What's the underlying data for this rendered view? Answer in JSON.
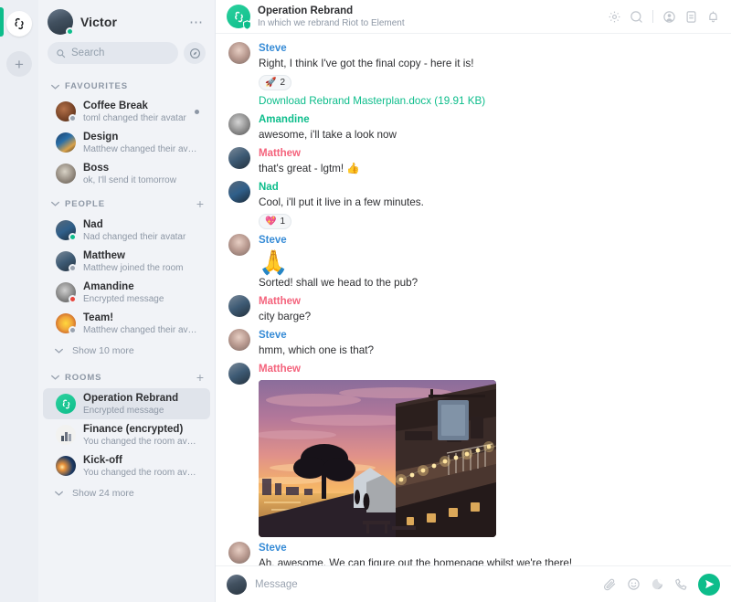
{
  "rail": {
    "home_icon": "element-logo-icon",
    "add_icon": "plus-icon",
    "accent_color": "#0dbd8b"
  },
  "sidebar": {
    "user": {
      "name": "Victor",
      "presence": "online",
      "menu_icon": "more-options-icon"
    },
    "search": {
      "placeholder": "Search",
      "icon": "search-icon",
      "explore_icon": "explore-compass-icon"
    },
    "sections": [
      {
        "title": "FAVOURITES",
        "has_add": false,
        "rooms": [
          {
            "name": "Coffee Break",
            "preview": "toml changed their avatar",
            "unread": true,
            "presence": "",
            "avatar": "coffee",
            "selected": false
          },
          {
            "name": "Design",
            "preview": "Matthew changed their avatar",
            "unread": false,
            "presence": "",
            "avatar": "design",
            "selected": false
          },
          {
            "name": "Boss",
            "preview": "ok, I'll send it tomorrow",
            "unread": false,
            "presence": "",
            "avatar": "boss",
            "selected": false
          }
        ],
        "show_more": ""
      },
      {
        "title": "PEOPLE",
        "has_add": true,
        "rooms": [
          {
            "name": "Nad",
            "preview": "Nad changed their avatar",
            "unread": false,
            "presence": "online",
            "avatar": "nad",
            "selected": false
          },
          {
            "name": "Matthew",
            "preview": "Matthew joined the room",
            "unread": false,
            "presence": "away",
            "avatar": "matthew",
            "selected": false
          },
          {
            "name": "Amandine",
            "preview": "Encrypted message",
            "unread": false,
            "presence": "busy",
            "avatar": "amandine",
            "selected": false
          },
          {
            "name": "Team!",
            "preview": "Matthew changed their avatar",
            "unread": false,
            "presence": "away",
            "avatar": "team",
            "selected": false
          }
        ],
        "show_more": "Show 10 more"
      },
      {
        "title": "ROOMS",
        "has_add": true,
        "rooms": [
          {
            "name": "Operation Rebrand",
            "preview": "Encrypted message",
            "unread": false,
            "presence": "",
            "avatar": "rebrand",
            "selected": true
          },
          {
            "name": "Finance (encrypted)",
            "preview": "You changed the room avatar",
            "unread": false,
            "presence": "",
            "avatar": "finance",
            "selected": false
          },
          {
            "name": "Kick-off",
            "preview": "You changed the room avatar",
            "unread": false,
            "presence": "",
            "avatar": "kickoff",
            "selected": false
          }
        ],
        "show_more": "Show 24 more"
      }
    ]
  },
  "room_header": {
    "title": "Operation Rebrand",
    "topic": "In which we rebrand Riot to Element",
    "icons": [
      "settings-gear-icon",
      "search-icon",
      "room-members-icon",
      "room-info-icon",
      "notifications-bell-icon"
    ]
  },
  "timeline": {
    "messages": [
      {
        "sender": "Steve",
        "sender_class": "s-steve",
        "avatar": "steve",
        "text": "Right, I think I've got the final copy - here it is!",
        "reaction": {
          "emoji": "🚀",
          "count": "2"
        },
        "file": "Download Rebrand Masterplan.docx (19.91 KB)"
      },
      {
        "sender": "Amandine",
        "sender_class": "s-amandine",
        "avatar": "amandine",
        "text": "awesome, i'll take a look now"
      },
      {
        "sender": "Matthew",
        "sender_class": "s-matthew",
        "avatar": "matthew",
        "text": "that's great - lgtm! 👍"
      },
      {
        "sender": "Nad",
        "sender_class": "s-nad",
        "avatar": "nad",
        "text": "Cool, i'll put it live in a few minutes.",
        "reaction": {
          "emoji": "💖",
          "count": "1"
        }
      },
      {
        "sender": "Steve",
        "sender_class": "s-steve",
        "avatar": "steve",
        "big_emoji": "🙏",
        "text": "Sorted! shall we head to the pub?"
      },
      {
        "sender": "Matthew",
        "sender_class": "s-matthew",
        "avatar": "matthew",
        "text": "city barge?"
      },
      {
        "sender": "Steve",
        "sender_class": "s-steve",
        "avatar": "steve",
        "text": "hmm, which one is that?"
      },
      {
        "sender": "Matthew",
        "sender_class": "s-matthew",
        "avatar": "matthew",
        "image": "sunset-riverside-pub-photo"
      },
      {
        "sender": "Steve",
        "sender_class": "s-steve",
        "avatar": "steve",
        "text": "Ah, awesome. We can figure out the homepage whilst we're there!"
      }
    ]
  },
  "composer": {
    "placeholder": "Message",
    "icons": [
      "attachment-paperclip-icon",
      "emoji-icon",
      "sticker-icon",
      "voice-call-icon"
    ],
    "send_icon": "send-icon"
  },
  "colors": {
    "accent": "#0dbd8b",
    "steve": "#368bd6",
    "matthew": "#f4637c",
    "green_name": "#0dbd8b"
  }
}
